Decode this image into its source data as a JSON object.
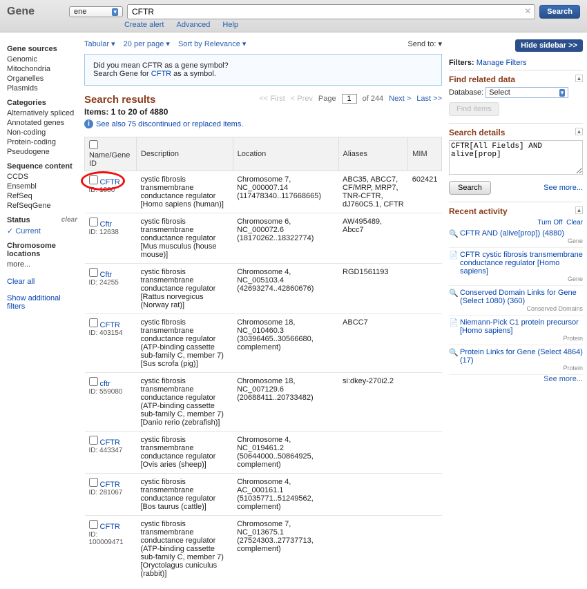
{
  "header": {
    "title": "Gene",
    "db_selected": "ene",
    "search_value": "CFTR",
    "search_btn": "Search",
    "create_alert": "Create alert",
    "advanced": "Advanced",
    "help": "Help"
  },
  "left": {
    "sources_h": "Gene sources",
    "sources": [
      "Genomic",
      "Mitochondria",
      "Organelles",
      "Plasmids"
    ],
    "cat_h": "Categories",
    "cats": [
      "Alternatively spliced",
      "Annotated genes",
      "Non-coding",
      "Protein-coding",
      "Pseudogene"
    ],
    "seq_h": "Sequence content",
    "seqs": [
      "CCDS",
      "Ensembl",
      "RefSeq",
      "RefSeqGene"
    ],
    "status_h": "Status",
    "status_clear": "clear",
    "status_cur": "Current",
    "chrom_h": "Chromosome locations",
    "more": "more...",
    "clear_all": "Clear all",
    "show_add": "Show additional filters"
  },
  "toolbar": {
    "tabular": "Tabular",
    "perpage": "20 per page",
    "sort": "Sort by Relevance",
    "sendto": "Send to:"
  },
  "dym": {
    "line1a": "Did you mean CFTR as a gene symbol?",
    "line2a": "Search Gene for ",
    "link": "CFTR",
    "line2b": " as a symbol."
  },
  "results": {
    "title": "Search results",
    "items": "Items: 1 to 20 of 4880",
    "seealso": "See also 75 discontinued or replaced items.",
    "pager": {
      "first": "<< First",
      "prev": "< Prev",
      "page_lbl": "Page",
      "page": "1",
      "of": "of 244",
      "next": "Next >",
      "last": "Last >>"
    },
    "cols": {
      "c1": "Name/Gene ID",
      "c2": "Description",
      "c3": "Location",
      "c4": "Aliases",
      "c5": "MIM"
    },
    "rows": [
      {
        "name": "CFTR",
        "id": "ID: 1080",
        "desc": "cystic fibrosis transmembrane conductance regulator [Homo sapiens (human)]",
        "loc": "Chromosome 7, NC_000007.14 (117478340..117668665)",
        "alias": "ABC35, ABCC7, CF/MRP, MRP7, TNR-CFTR, dJ760C5.1, CFTR",
        "mim": "602421"
      },
      {
        "name": "Cftr",
        "id": "ID: 12638",
        "desc": "cystic fibrosis transmembrane conductance regulator [Mus musculus (house mouse)]",
        "loc": "Chromosome 6, NC_000072.6 (18170262..18322774)",
        "alias": "AW495489, Abcc7",
        "mim": ""
      },
      {
        "name": "Cftr",
        "id": "ID: 24255",
        "desc": "cystic fibrosis transmembrane conductance regulator [Rattus norvegicus (Norway rat)]",
        "loc": "Chromosome 4, NC_005103.4 (42693274..42860676)",
        "alias": "RGD1561193",
        "mim": ""
      },
      {
        "name": "CFTR",
        "id": "ID: 403154",
        "desc": "cystic fibrosis transmembrane conductance regulator (ATP-binding cassette sub-family C, member 7) [Sus scrofa (pig)]",
        "loc": "Chromosome 18, NC_010460.3 (30396465..30566680, complement)",
        "alias": "ABCC7",
        "mim": ""
      },
      {
        "name": "cftr",
        "id": "ID: 559080",
        "desc": "cystic fibrosis transmembrane conductance regulator (ATP-binding cassette sub-family C, member 7) [Danio rerio (zebrafish)]",
        "loc": "Chromosome 18, NC_007129.6 (20688411..20733482)",
        "alias": "si:dkey-270i2.2",
        "mim": ""
      },
      {
        "name": "CFTR",
        "id": "ID: 443347",
        "desc": "cystic fibrosis transmembrane conductance regulator [Ovis aries (sheep)]",
        "loc": "Chromosome 4, NC_019461.2 (50644000..50864925, complement)",
        "alias": "",
        "mim": ""
      },
      {
        "name": "CFTR",
        "id": "ID: 281067",
        "desc": "cystic fibrosis transmembrane conductance regulator [Bos taurus (cattle)]",
        "loc": "Chromosome 4, AC_000161.1 (51035771..51249562, complement)",
        "alias": "",
        "mim": ""
      },
      {
        "name": "CFTR",
        "id": "ID: 100009471",
        "desc": "cystic fibrosis transmembrane conductance regulator (ATP-binding cassette sub-family C, member 7) [Oryctolagus cuniculus (rabbit)]",
        "loc": "Chromosome 7, NC_013675.1 (27524303..27737713, complement)",
        "alias": "",
        "mim": ""
      }
    ]
  },
  "right": {
    "hide": "Hide sidebar >>",
    "filters_lbl": "Filters:",
    "manage": "Manage Filters",
    "related_h": "Find related data",
    "db_lbl": "Database:",
    "db_sel": "Select",
    "find_items": "Find items",
    "details_h": "Search details",
    "details_val": "CFTR[All Fields] AND alive[prop]",
    "search_btn": "Search",
    "seemore": "See more...",
    "recent_h": "Recent activity",
    "turnoff": "Turn Off",
    "clear": "Clear",
    "recent": [
      {
        "ico": "🔍",
        "t": "CFTR AND (alive[prop]) (4880)",
        "s": "Gene"
      },
      {
        "ico": "📄",
        "t": "CFTR cystic fibrosis transmembrane conductance regulator [Homo sapiens]",
        "s": "Gene"
      },
      {
        "ico": "🔍",
        "t": "Conserved Domain Links for Gene (Select 1080) (360)",
        "s": "Conserved Domains"
      },
      {
        "ico": "📄",
        "t": "Niemann-Pick C1 protein precursor [Homo sapiens]",
        "s": "Protein"
      },
      {
        "ico": "🔍",
        "t": "Protein Links for Gene (Select 4864) (17)",
        "s": "Protein"
      }
    ]
  }
}
